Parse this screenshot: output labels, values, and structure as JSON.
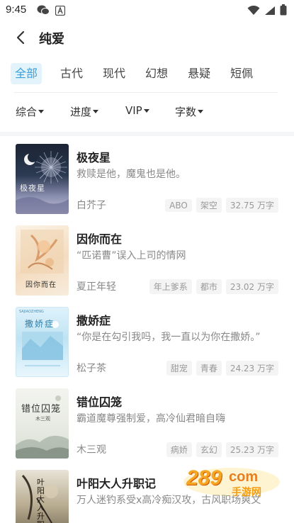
{
  "status_bar": {
    "time": "9:45"
  },
  "header": {
    "title": "纯爱"
  },
  "tabs": [
    {
      "label": "全部",
      "active": true
    },
    {
      "label": "古代",
      "active": false
    },
    {
      "label": "现代",
      "active": false
    },
    {
      "label": "幻想",
      "active": false
    },
    {
      "label": "悬疑",
      "active": false
    },
    {
      "label": "短佩",
      "active": false
    }
  ],
  "filters": [
    {
      "label": "综合"
    },
    {
      "label": "进度"
    },
    {
      "label": "VIP"
    },
    {
      "label": "字数"
    }
  ],
  "books": [
    {
      "title": "极夜星",
      "desc": "救赎是他，魔鬼也是他。",
      "author": "白芥子",
      "tags": [
        "ABO",
        "架空"
      ],
      "words": "32.75 万字",
      "cover_text": "极夜星"
    },
    {
      "title": "因你而在",
      "desc": "“匹诺曹”误入上司的情网",
      "author": "夏正年轻",
      "tags": [
        "年上爹系",
        "都市"
      ],
      "words": "23.02 万字",
      "cover_text": "因你而在"
    },
    {
      "title": "撒娇症",
      "desc": "“你是在勾引我吗，我一直以为你在撒娇。”",
      "author": "松子茶",
      "tags": [
        "甜宠",
        "青春"
      ],
      "words": "24.23 万字",
      "cover_text": "撒娇症"
    },
    {
      "title": "错位囚笼",
      "desc": "霸道魔尊强制爱，高冷仙君暗自嗨",
      "author": "木三观",
      "tags": [
        "病娇",
        "玄幻"
      ],
      "words": "25.23 万字",
      "cover_text": "错位囚笼",
      "cover_author": "木三观"
    },
    {
      "title": "叶阳大人升职记",
      "desc": "万人迷钓系受x高冷痴汉攻，古风职场爽文",
      "author": "",
      "tags": [],
      "words": "",
      "cover_text": "叶阳大人升职记"
    }
  ],
  "cover_subtitles": {
    "book2": "SAJIAOZHENG"
  },
  "watermark": {
    "main": "289",
    "suffix": "com",
    "sub": "手游网"
  },
  "colors": {
    "accent": "#3aa0d9",
    "accent_bg": "#e3f3fb",
    "muted": "#888888"
  }
}
